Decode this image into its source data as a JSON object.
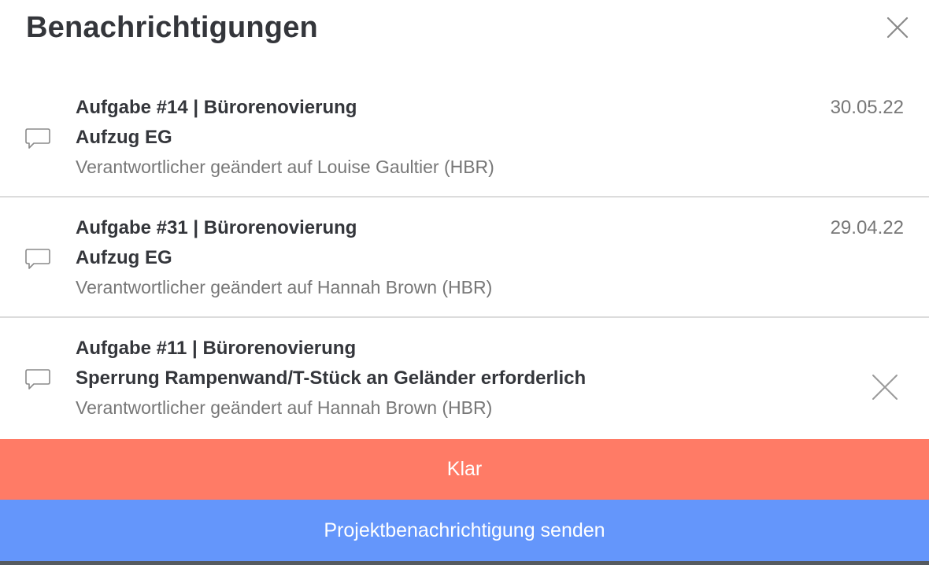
{
  "header": {
    "title": "Benachrichtigungen",
    "close_icon": "close-icon"
  },
  "notifications": [
    {
      "icon": "speech-bubble-icon",
      "task": "Aufgabe #14 | Bürorenovierung",
      "subject": "Aufzug EG",
      "message": "Verantwortlicher geändert auf Louise Gaultier (HBR)",
      "date": "30.05.22"
    },
    {
      "icon": "speech-bubble-icon",
      "task": "Aufgabe #31 | Bürorenovierung",
      "subject": "Aufzug EG",
      "message": "Verantwortlicher geändert auf Hannah Brown (HBR)",
      "date": "29.04.22"
    },
    {
      "icon": "speech-bubble-icon",
      "task": "Aufgabe #11 | Bürorenovierung",
      "subject": "Sperrung Rampenwand/T-Stück an Geländer erforderlich",
      "message": "Verantwortlicher geändert auf Hannah Brown (HBR)",
      "dismiss_icon": "close-icon"
    }
  ],
  "actions": {
    "done_label": "Klar",
    "send_label": "Projektbenachrichtigung senden"
  },
  "colors": {
    "done_button": "#ff7b66",
    "send_button": "#6496fb",
    "title_text": "#34363b",
    "secondary_text": "#777777",
    "divider": "#dcdcdc"
  }
}
